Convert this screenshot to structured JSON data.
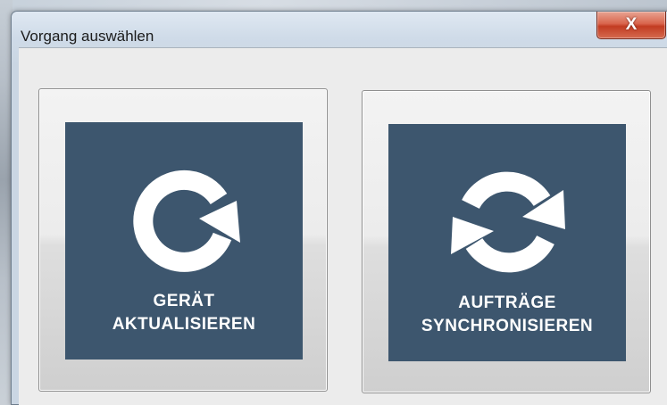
{
  "window": {
    "title": "Vorgang auswählen",
    "close_label": "X"
  },
  "tiles": [
    {
      "line1": "GERÄT",
      "line2": "AKTUALISIEREN",
      "icon": "refresh-icon"
    },
    {
      "line1": "AUFTRÄGE",
      "line2": "SYNCHRONISIEREN",
      "icon": "sync-icon"
    }
  ],
  "colors": {
    "tile_panel": "#3d566e",
    "close_button": "#c23c22"
  }
}
